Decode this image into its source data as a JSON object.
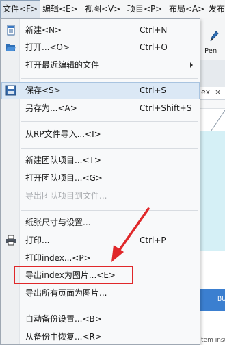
{
  "menubar": {
    "items": [
      {
        "label": "文件<F>"
      },
      {
        "label": "编辑<E>"
      },
      {
        "label": "视图<V>"
      },
      {
        "label": "项目<P>"
      },
      {
        "label": "布局<A>"
      },
      {
        "label": "发布"
      }
    ]
  },
  "background": {
    "tool_label": "Pen",
    "tab_label": "ex",
    "tab_close": "×",
    "bottom_text": "tem insu",
    "blue_label": "BU"
  },
  "file_menu": {
    "items": [
      {
        "label": "新建<N>",
        "shortcut": "Ctrl+N",
        "icon": "new-file-icon"
      },
      {
        "label": "打开...<O>",
        "shortcut": "Ctrl+O",
        "icon": "open-folder-icon"
      },
      {
        "label": "打开最近编辑的文件",
        "has_submenu": true
      },
      {
        "label": "保存<S>",
        "shortcut": "Ctrl+S",
        "icon": "save-icon"
      },
      {
        "label": "另存为...<A>",
        "shortcut": "Ctrl+Shift+S"
      },
      {
        "label": "从RP文件导入...<I>"
      },
      {
        "label": "新建团队项目...<T>"
      },
      {
        "label": "打开团队项目...<G>"
      },
      {
        "label": "导出团队项目到文件...",
        "disabled": true
      },
      {
        "label": "纸张尺寸与设置..."
      },
      {
        "label": "打印...",
        "shortcut": "Ctrl+P",
        "icon": "print-icon"
      },
      {
        "label": "打印index...<P>"
      },
      {
        "label": "导出index为图片...<E>"
      },
      {
        "label": "导出所有页面为图片..."
      },
      {
        "label": "自动备份设置...<B>"
      },
      {
        "label": "从备份中恢复...<R>"
      }
    ]
  },
  "colors": {
    "annotation": "#e0282a",
    "highlight": "#dbe8f5"
  }
}
